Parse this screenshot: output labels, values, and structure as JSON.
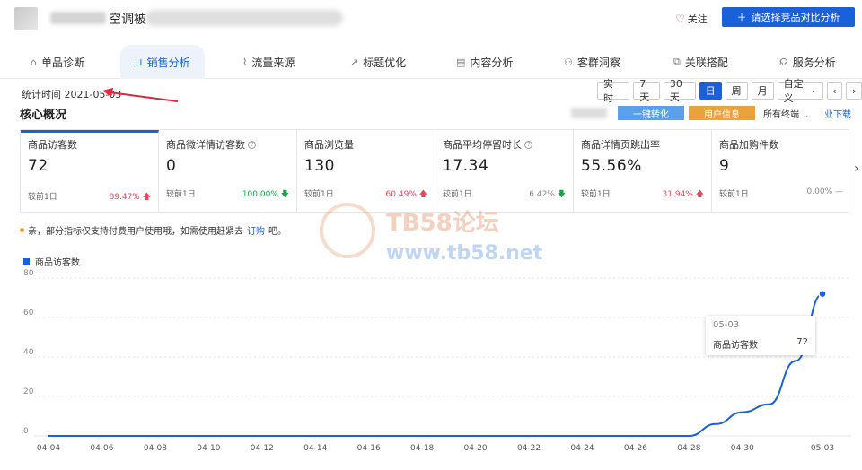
{
  "header": {
    "product_name": "空调被",
    "follow_label": "关注",
    "compare_button": "请选择竞品对比分析"
  },
  "tabs": [
    {
      "label": "单品诊断",
      "icon": "house-icon"
    },
    {
      "label": "销售分析",
      "icon": "bag-icon",
      "active": true
    },
    {
      "label": "流量来源",
      "icon": "line-chart-icon"
    },
    {
      "label": "标题优化",
      "icon": "trend-icon"
    },
    {
      "label": "内容分析",
      "icon": "document-icon"
    },
    {
      "label": "客群洞察",
      "icon": "users-icon"
    },
    {
      "label": "关联搭配",
      "icon": "link-icon"
    },
    {
      "label": "服务分析",
      "icon": "headset-icon"
    }
  ],
  "stat_time": {
    "label": "统计时间 2021-05-03"
  },
  "range_buttons": [
    "实 时",
    "7天",
    "30天",
    "日",
    "周",
    "月",
    "自定义"
  ],
  "range_active": "日",
  "core": {
    "title": "核心概况",
    "optimize_label": "一键转化",
    "userinfo_label": "用户信息",
    "terminal_label": "所有终端",
    "download_label": "业下载"
  },
  "metrics": [
    {
      "label": "商品访客数",
      "value": "72",
      "compare": "较前1日",
      "pct": "89.47%",
      "trend": "up",
      "help": false
    },
    {
      "label": "商品微详情访客数",
      "value": "0",
      "compare": "较前1日",
      "pct": "100.00%",
      "trend": "down",
      "help": true
    },
    {
      "label": "商品浏览量",
      "value": "130",
      "compare": "较前1日",
      "pct": "60.49%",
      "trend": "up",
      "help": false
    },
    {
      "label": "商品平均停留时长",
      "value": "17.34",
      "compare": "较前1日",
      "pct": "6.42%",
      "trend": "down",
      "help": true
    },
    {
      "label": "商品详情页跳出率",
      "value": "55.56%",
      "compare": "较前1日",
      "pct": "31.94%",
      "trend": "up",
      "help": false
    },
    {
      "label": "商品加购件数",
      "value": "9",
      "compare": "较前1日",
      "pct": "0.00%",
      "trend": "flat",
      "help": false
    }
  ],
  "notice": {
    "text": "亲，部分指标仅支持付费用户使用哦，如需使用赶紧去",
    "link": "订购",
    "suffix": "吧。"
  },
  "watermark": {
    "title": "TB58论坛",
    "url": "www.tb58.net"
  },
  "tooltip": {
    "date": "05-03",
    "label": "商品访客数",
    "value": "72"
  },
  "colors": {
    "accent": "#1a60d8",
    "up": "#e8465b",
    "down": "#1aa34a",
    "userinfo": "#e9a33c",
    "optimize": "#5aa0ea"
  },
  "chart_data": {
    "type": "line",
    "legend": [
      "商品访客数"
    ],
    "ylim": [
      0,
      80
    ],
    "yticks": [
      0,
      20,
      40,
      60,
      80
    ],
    "xticks": [
      "04-04",
      "04-06",
      "04-08",
      "04-10",
      "04-12",
      "04-14",
      "04-16",
      "04-18",
      "04-20",
      "04-22",
      "04-24",
      "04-26",
      "04-28",
      "04-30",
      "05-03"
    ],
    "x": [
      "04-04",
      "04-05",
      "04-06",
      "04-07",
      "04-08",
      "04-09",
      "04-10",
      "04-11",
      "04-12",
      "04-13",
      "04-14",
      "04-15",
      "04-16",
      "04-17",
      "04-18",
      "04-19",
      "04-20",
      "04-21",
      "04-22",
      "04-23",
      "04-24",
      "04-25",
      "04-26",
      "04-27",
      "04-28",
      "04-29",
      "04-30",
      "05-01",
      "05-02",
      "05-03"
    ],
    "series": [
      {
        "name": "商品访客数",
        "values": [
          0,
          0,
          0,
          0,
          0,
          0,
          0,
          0,
          0,
          0,
          0,
          0,
          0,
          0,
          0,
          0,
          0,
          0,
          0,
          0,
          0,
          0,
          0,
          0,
          0,
          6,
          12,
          16,
          38,
          72
        ]
      }
    ],
    "grid": true
  }
}
